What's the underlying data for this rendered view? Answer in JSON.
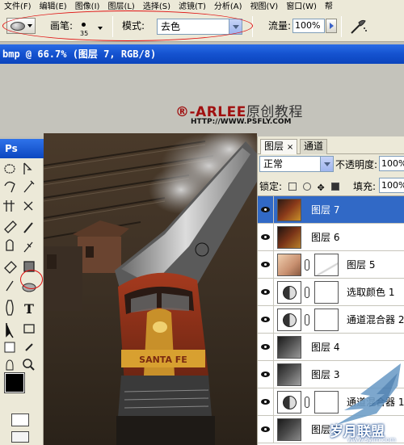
{
  "menubar": {
    "items": [
      "文件(F)",
      "编辑(E)",
      "图像(I)",
      "图层(L)",
      "选择(S)",
      "滤镜(T)",
      "分析(A)",
      "视图(V)",
      "窗口(W)",
      "帮"
    ]
  },
  "options": {
    "brush_label": "画笔:",
    "brush_size": "35",
    "mode_label": "模式:",
    "mode_value": "去色",
    "flow_label": "流量:",
    "flow_value": "100%"
  },
  "document": {
    "title": "bmp @ 66.7% (图层 7, RGB/8)"
  },
  "banner": {
    "brand_mark": "®",
    "brand_name": "-ARLEE",
    "brand_cn": "原创教程",
    "url": "HTTP://WWW.PSFLY.COM"
  },
  "tools": {
    "title": "Ps"
  },
  "layers_panel": {
    "tabs": [
      "图层",
      "通道"
    ],
    "tab_close": "×",
    "blend_mode": "正常",
    "opacity_label": "不透明度:",
    "opacity_value": "100%",
    "lock_label": "锁定:",
    "fill_label": "填充:",
    "fill_value": "100%",
    "layers": [
      {
        "name": "图层 7",
        "selected": true,
        "mask": false
      },
      {
        "name": "图层 6",
        "selected": false,
        "mask": false
      },
      {
        "name": "图层 5",
        "selected": false,
        "mask": true
      },
      {
        "name": "选取颜色 1",
        "selected": false,
        "mask": true
      },
      {
        "name": "通道混合器 2",
        "selected": false,
        "mask": true
      },
      {
        "name": "图层 4",
        "selected": false,
        "mask": false
      },
      {
        "name": "图层 3",
        "selected": false,
        "mask": false
      },
      {
        "name": "通道混合器 1",
        "selected": false,
        "mask": true
      },
      {
        "name": "图层 2",
        "selected": false,
        "mask": false
      }
    ]
  },
  "watermark": {
    "text": "岁月联盟",
    "url": "www.sylm.com"
  },
  "colors": {
    "accent": "#3169c6",
    "title_bar": "#1452cf",
    "annotation_ring": "#e01010",
    "brand_red": "#a01010"
  }
}
